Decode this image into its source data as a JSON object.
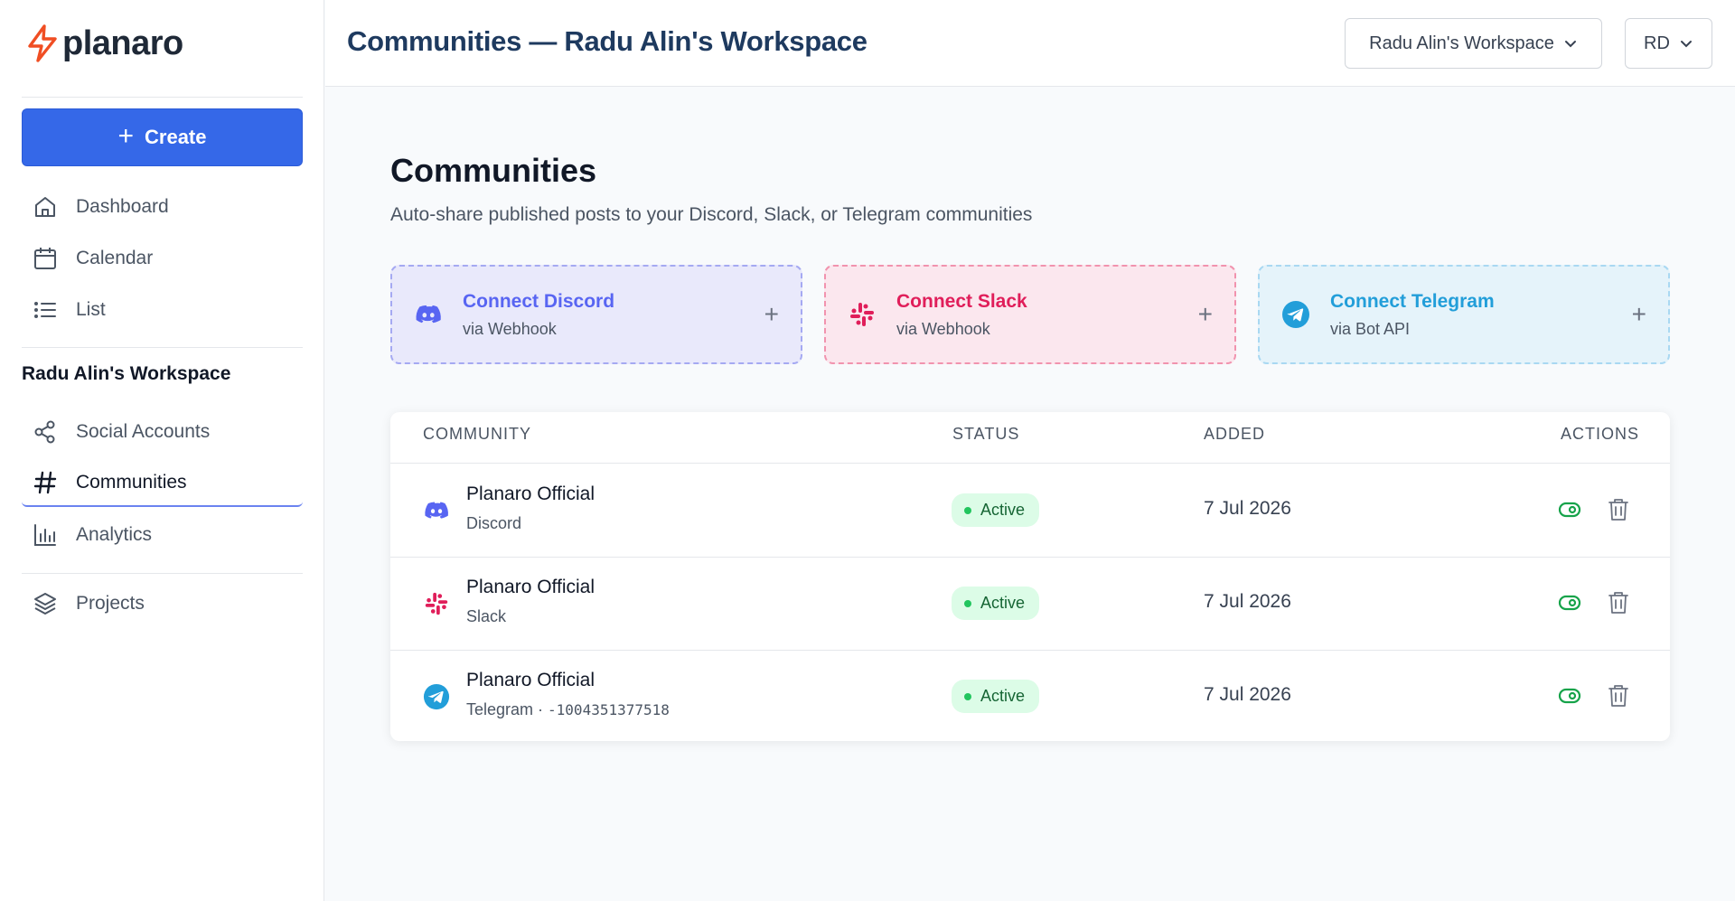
{
  "brand": {
    "name": "planaro",
    "accent": "#f04e23"
  },
  "sidebar": {
    "create_label": "Create",
    "nav": [
      {
        "label": "Dashboard",
        "icon": "home-icon"
      },
      {
        "label": "Calendar",
        "icon": "calendar-icon"
      },
      {
        "label": "List",
        "icon": "list-icon"
      }
    ],
    "workspace_label": "Radu Alin's Workspace",
    "workspace_nav": [
      {
        "label": "Social Accounts",
        "icon": "share-icon"
      },
      {
        "label": "Communities",
        "icon": "hash-icon",
        "active": true
      },
      {
        "label": "Analytics",
        "icon": "bar-chart-icon"
      }
    ],
    "projects_label": "Projects"
  },
  "header": {
    "title": "Communities — Radu Alin's Workspace",
    "workspace_select": "Radu Alin's Workspace",
    "user_initials": "RD"
  },
  "main": {
    "title": "Communities",
    "subtitle": "Auto-share published posts to your Discord, Slack, or Telegram communities",
    "connect_cards": [
      {
        "title": "Connect Discord",
        "sub": "via Webhook",
        "color": "#5865f2"
      },
      {
        "title": "Connect Slack",
        "sub": "via Webhook",
        "color": "#e01e5a"
      },
      {
        "title": "Connect Telegram",
        "sub": "via Bot API",
        "color": "#229ed9"
      }
    ],
    "table": {
      "columns": [
        "COMMUNITY",
        "STATUS",
        "ADDED",
        "ACTIONS"
      ],
      "rows": [
        {
          "name": "Planaro Official",
          "platform": "Discord",
          "chat_id": "",
          "status": "Active",
          "added": "7 Jul 2026"
        },
        {
          "name": "Planaro Official",
          "platform": "Slack",
          "chat_id": "",
          "status": "Active",
          "added": "7 Jul 2026"
        },
        {
          "name": "Planaro Official",
          "platform": "Telegram",
          "chat_id": "-1004351377518",
          "status": "Active",
          "added": "7 Jul 2026"
        }
      ]
    }
  }
}
